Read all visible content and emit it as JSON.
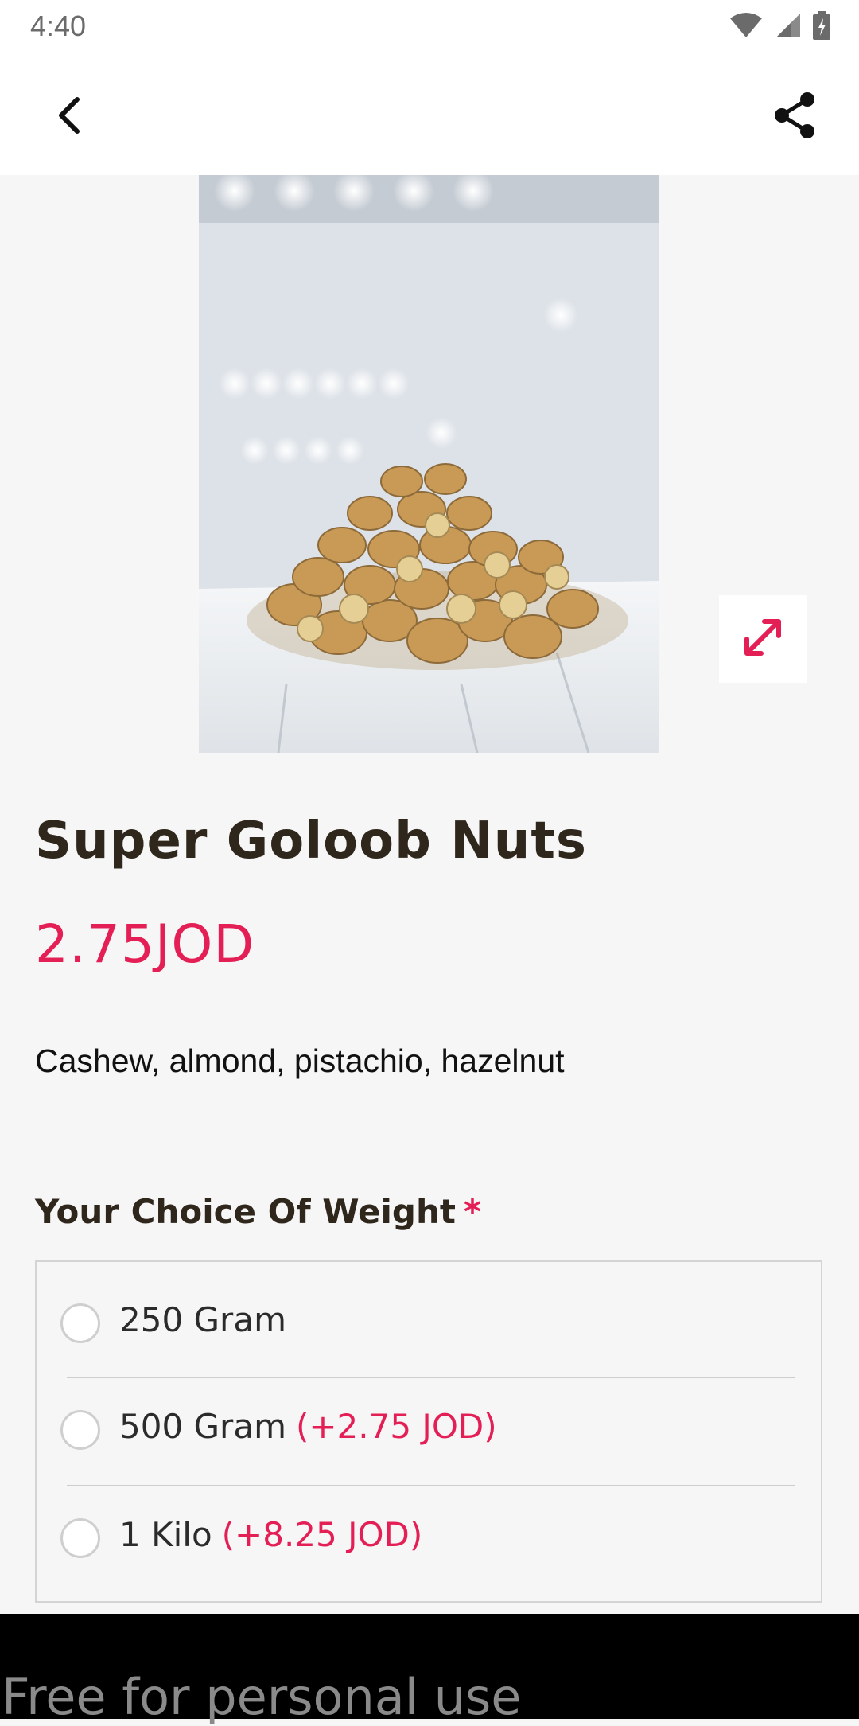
{
  "status_bar": {
    "time": "4:40",
    "icons": [
      "wifi-icon",
      "signal-icon",
      "battery-icon"
    ]
  },
  "app_bar": {
    "back_icon": "chevron-left-icon",
    "share_icon": "share-icon"
  },
  "product": {
    "image_alt": "mixed nuts",
    "expand_icon": "expand-icon",
    "title": "Super Goloob Nuts",
    "price": "2.75JOD",
    "description": "Cashew, almond, pistachio, hazelnut"
  },
  "weight_section": {
    "label": "Your Choice Of Weight",
    "required_mark": "*",
    "options": [
      {
        "label": "250 Gram",
        "extra": ""
      },
      {
        "label": "500 Gram",
        "extra": "(+2.75 JOD)"
      },
      {
        "label": "1 Kilo",
        "extra": "(+8.25 JOD)"
      }
    ]
  },
  "watermark": {
    "text": "Free for personal use"
  },
  "colors": {
    "accent": "#e41f55",
    "title": "#2f261c",
    "background": "#f6f6f6"
  }
}
